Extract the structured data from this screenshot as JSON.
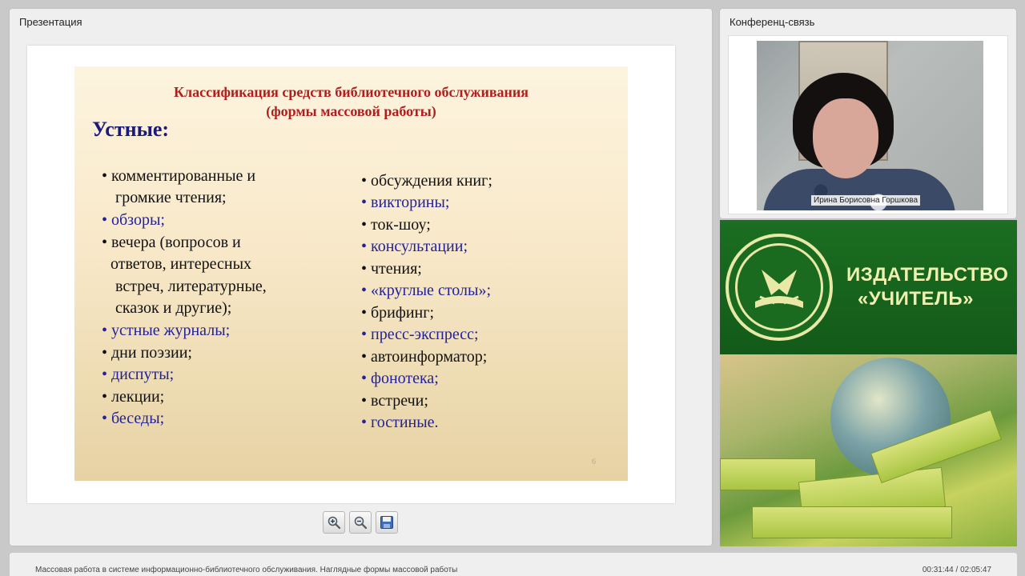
{
  "presentation": {
    "title": "Презентация",
    "slide": {
      "title_line1": "Классификация средств библиотечного обслуживания",
      "title_line2": "(формы массовой работы)",
      "heading": "Устные:",
      "left_items": [
        "• комментированные и",
        "громкие чтения;",
        "• обзоры;",
        "• вечера (вопросов и",
        "ответов,   интересных",
        "встреч, литературные,",
        "сказок и другие);",
        "• устные журналы;",
        "• дни поэзии;",
        "• диспуты;",
        "• лекции;",
        "• беседы;"
      ],
      "right_items": [
        "• обсуждения книг;",
        "• викторины;",
        "• ток-шоу;",
        "•  консультации;",
        "•  чтения;",
        "•  «круглые столы»;",
        "•  брифинг;",
        "•  пресс-экспресс;",
        "•  автоинформатор;",
        "•  фонотека;",
        "•  встречи;",
        "•  гостиные."
      ],
      "page_number": "6"
    },
    "toolbar": {
      "zoom_in_icon": "zoom-in-icon",
      "zoom_out_icon": "zoom-out-icon",
      "save_icon": "save-icon"
    }
  },
  "conference": {
    "title": "Конференц-связь",
    "speaker_name": "Ирина Борисовна Горшкова"
  },
  "banner": {
    "line1": "ИЗДАТЕЛЬСТВО",
    "line2": "«УЧИТЕЛЬ»",
    "colors": {
      "green": "#1b6e22",
      "text": "#eef0b0"
    }
  },
  "status": {
    "title": "Массовая работа в системе информационно-библиотечного обслуживания. Наглядные формы массовой работы",
    "time": "00:31:44 / 02:05:47"
  }
}
